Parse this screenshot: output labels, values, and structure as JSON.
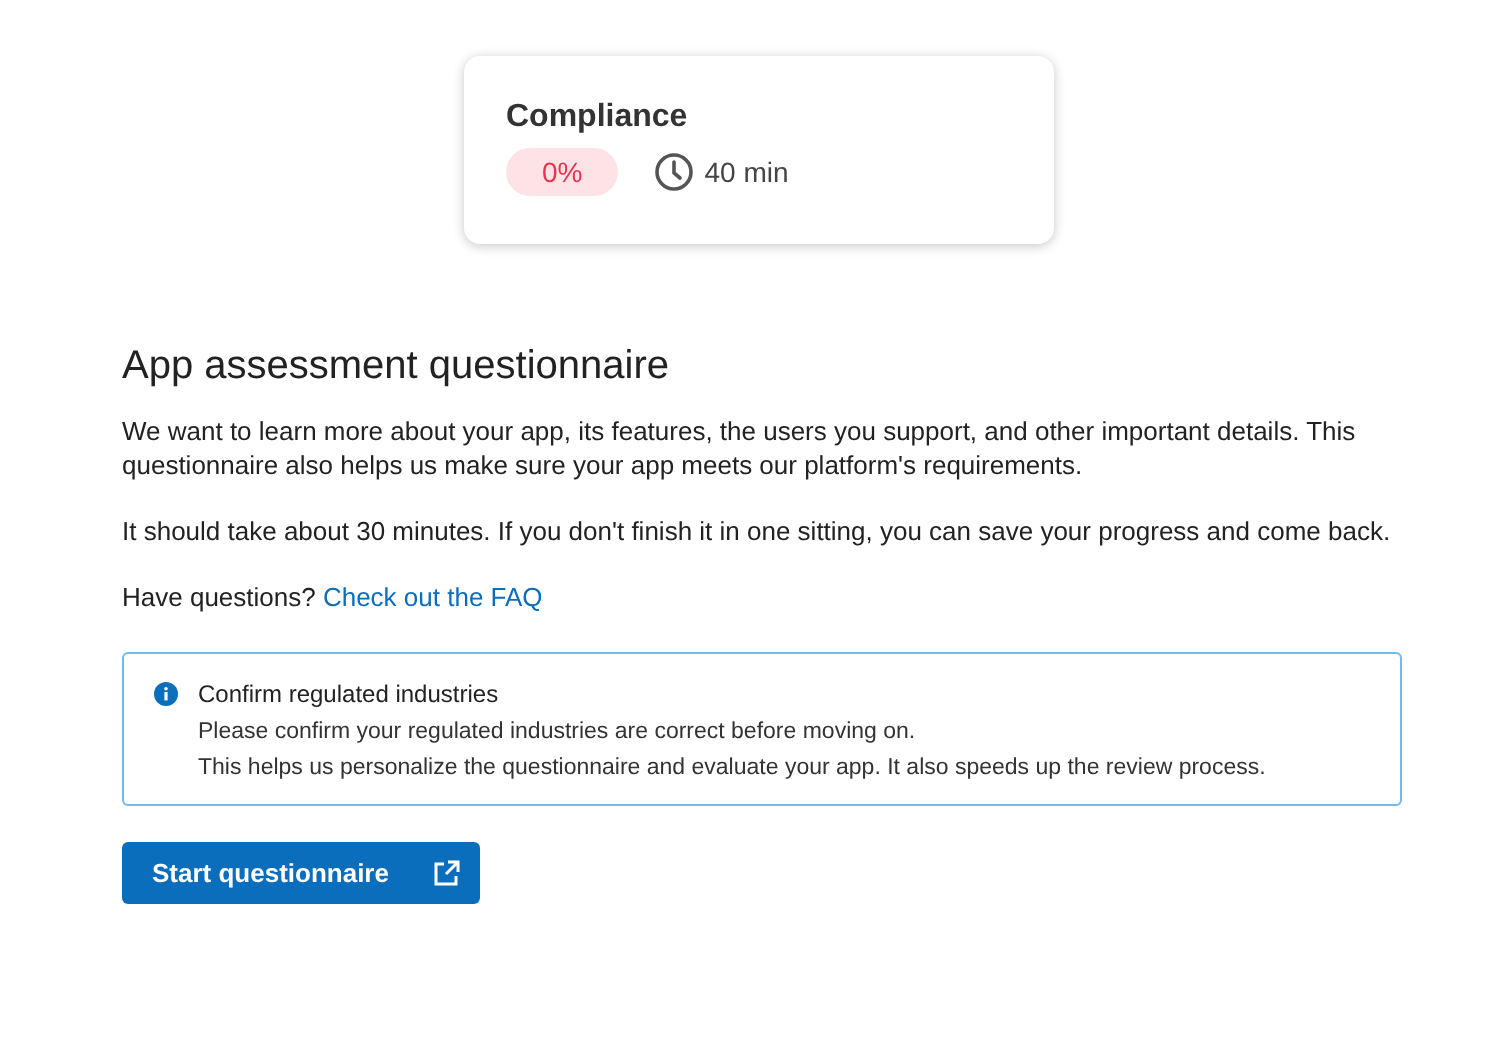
{
  "summary_card": {
    "title": "Compliance",
    "score": "0%",
    "duration": "40 min"
  },
  "heading": "App assessment questionnaire",
  "paragraphs": [
    "We want to learn more about your app, its features, the users you support, and other important details. This questionnaire also helps us make sure your app meets our platform's requirements.",
    "It should take about 30 minutes. If you don't finish it in one sitting, you can save your progress and come back."
  ],
  "faq": {
    "text": "Have questions?",
    "link": "Check out the FAQ"
  },
  "notice": {
    "kind": "info",
    "title": "Confirm regulated industries",
    "lines": [
      "Please confirm your regulated industries are correct before moving on.",
      "This helps us personalize the questionnaire and evaluate your app. It also speeds up the review process."
    ]
  },
  "button": {
    "label": "Start questionnaire"
  }
}
